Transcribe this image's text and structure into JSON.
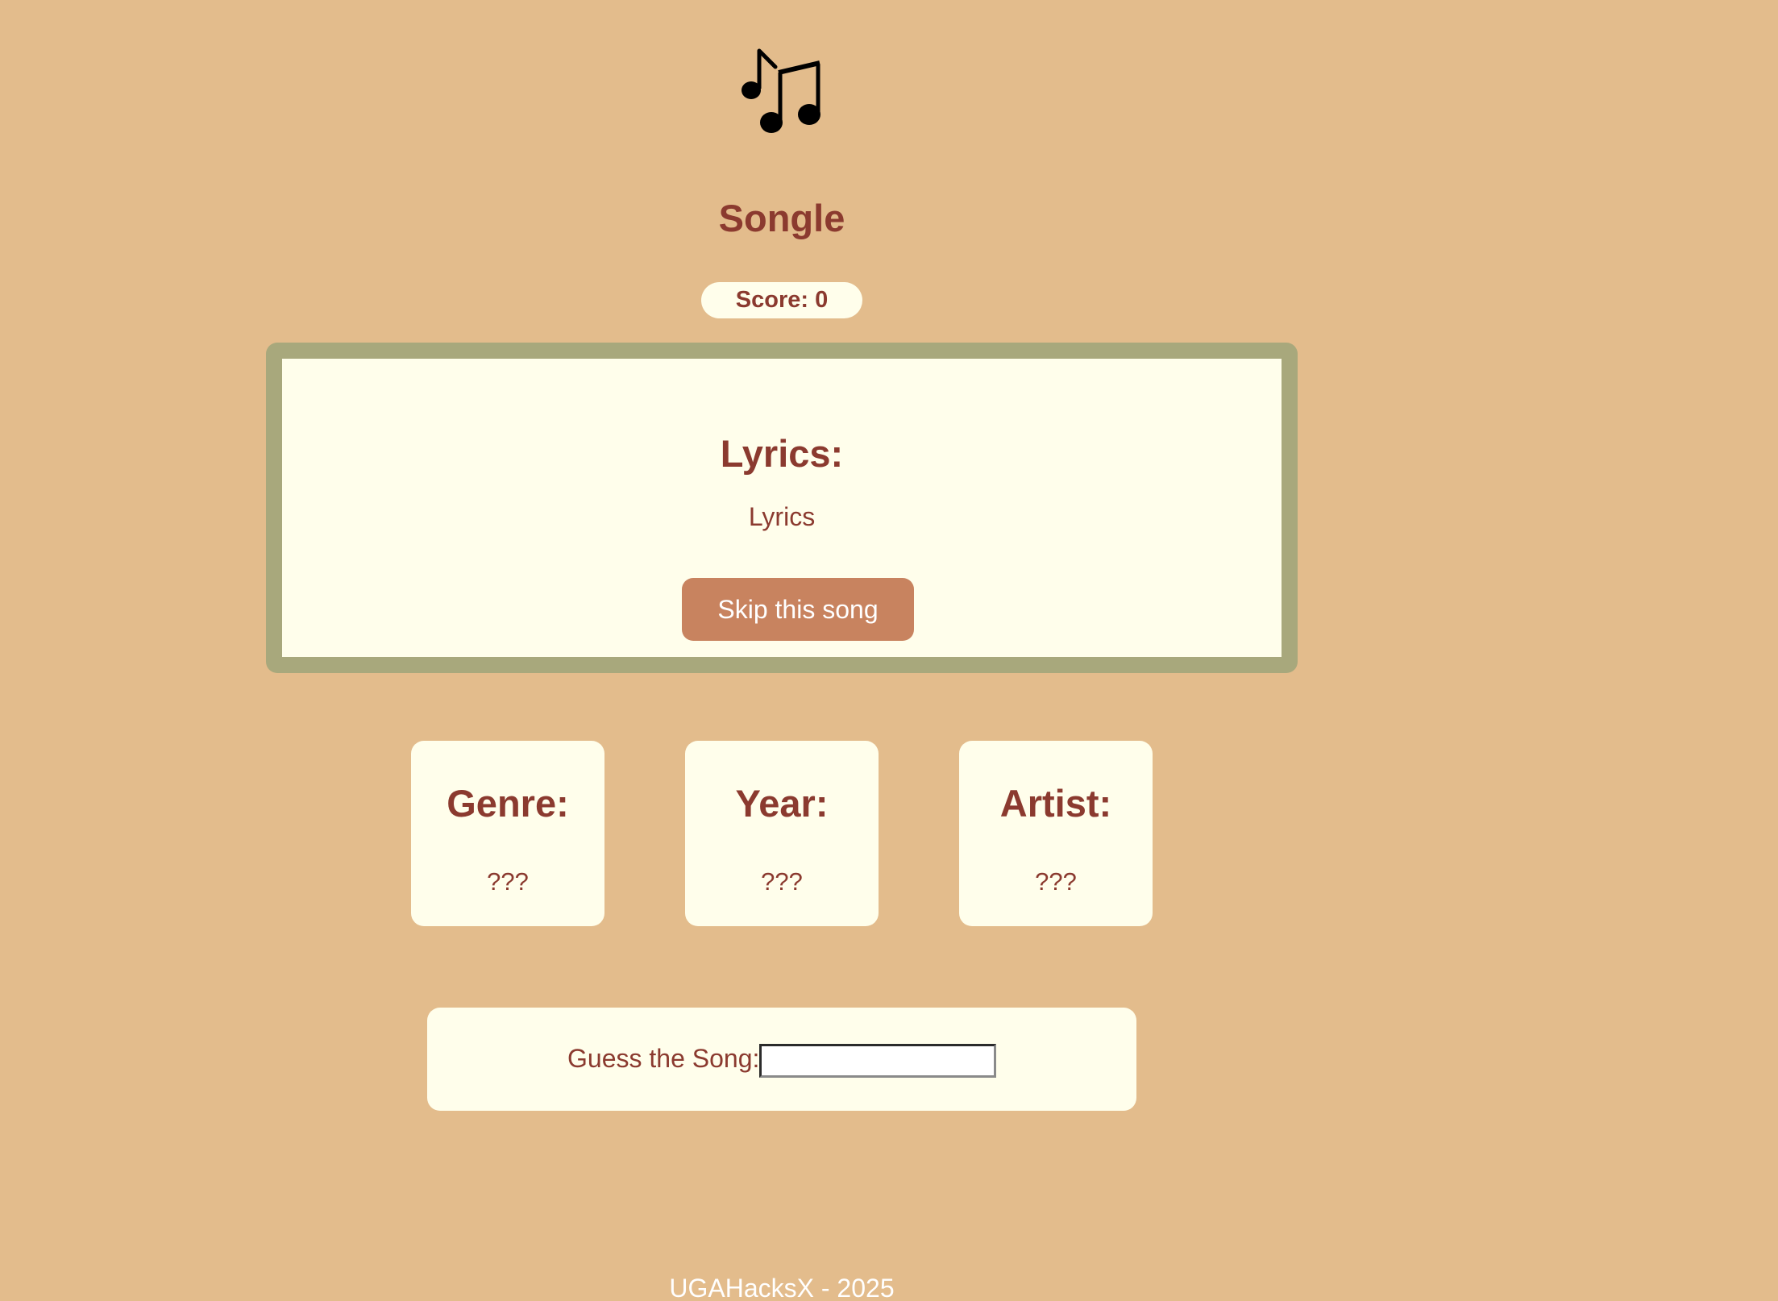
{
  "app": {
    "title": "Songle",
    "logo_icon": "music-notes-icon"
  },
  "score": {
    "label": "Score: 0"
  },
  "lyrics": {
    "heading": "Lyrics:",
    "text": "Lyrics",
    "skip_label": "Skip this song"
  },
  "hints": [
    {
      "label": "Genre:",
      "value": "???"
    },
    {
      "label": "Year:",
      "value": "???"
    },
    {
      "label": "Artist:",
      "value": "???"
    }
  ],
  "guess": {
    "label": "Guess the Song:",
    "value": ""
  },
  "footer": {
    "text": "UGAHacksX - 2025"
  },
  "colors": {
    "background": "#e3bc8c",
    "panel": "#fffeeb",
    "accent_text": "#8b3a2f",
    "frame": "#a8a87c",
    "button": "#c8835f"
  }
}
